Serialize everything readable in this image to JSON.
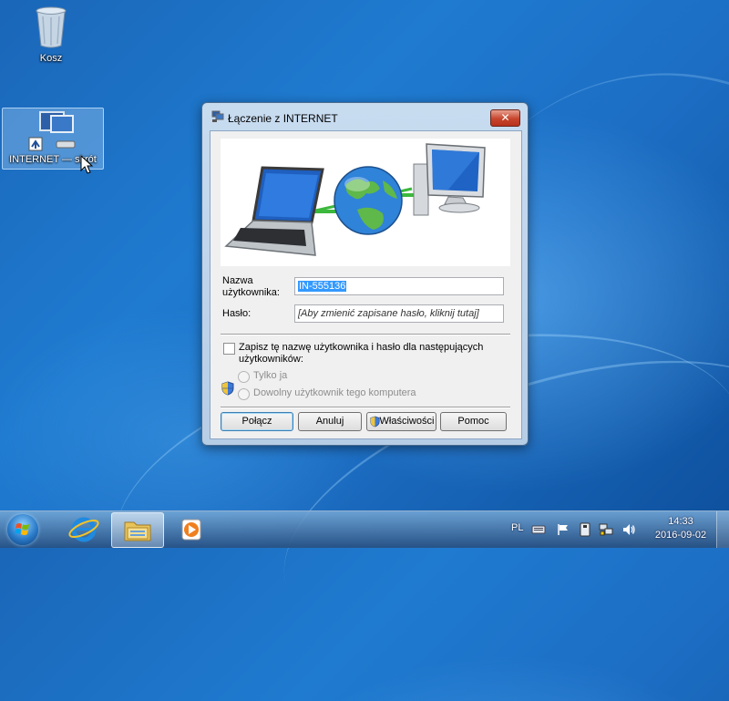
{
  "desktop": {
    "icons": [
      {
        "label": "Kosz"
      },
      {
        "label": "INTERNET — skrót"
      }
    ]
  },
  "dialog": {
    "title": "Łączenie z INTERNET",
    "close_label": "✕",
    "username_label_line1": "Nazwa",
    "username_label_line2": "użytkownika:",
    "username_value": "IN-555136",
    "password_label": "Hasło:",
    "password_value": "[Aby zmienić zapisane hasło, kliknij tutaj]",
    "save_checkbox_line1": "Zapisz tę nazwę użytkownika i hasło dla następujących",
    "save_checkbox_line2": "użytkowników:",
    "save_checked": false,
    "radio_only_me": "Tylko ja",
    "radio_anyone": "Dowolny użytkownik tego komputera",
    "buttons": {
      "connect": "Połącz",
      "cancel": "Anuluj",
      "properties": "Właściwości",
      "help": "Pomoc"
    }
  },
  "taskbar": {
    "language": "PL",
    "time": "14:33",
    "date": "2016-09-02"
  }
}
